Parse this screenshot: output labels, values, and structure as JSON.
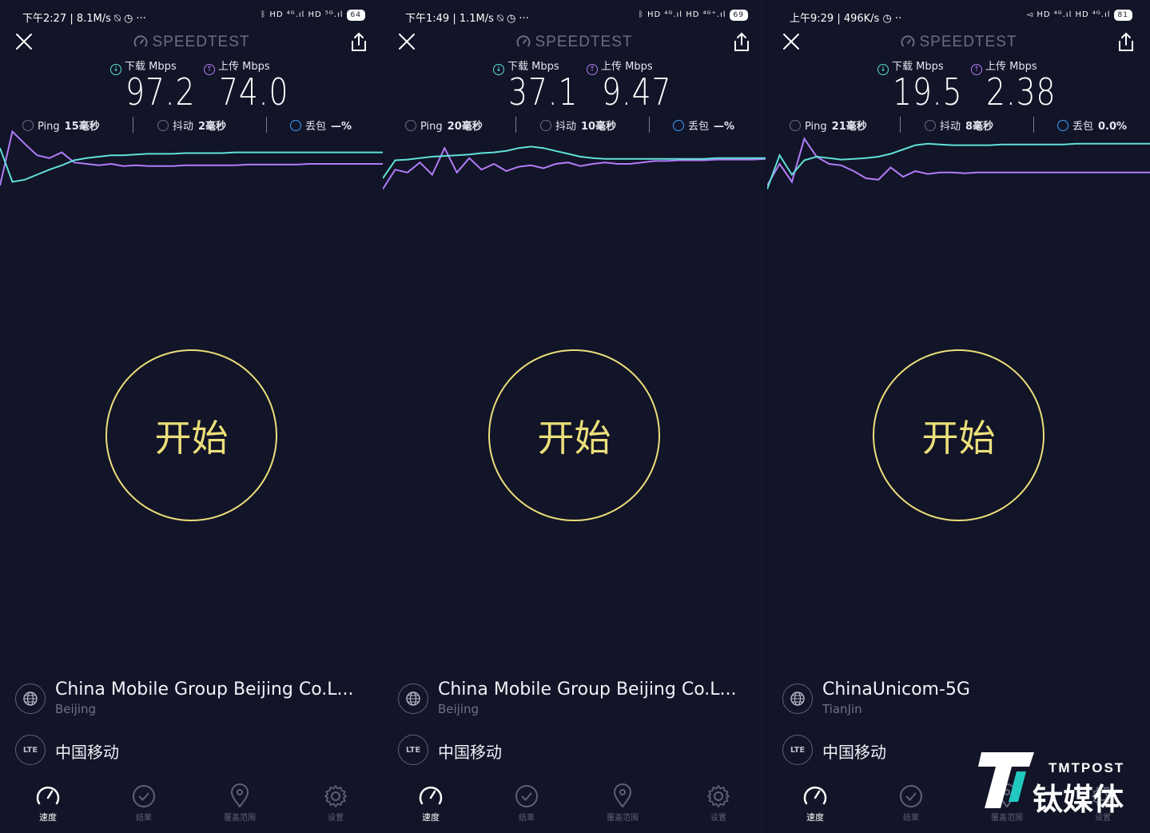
{
  "panels": [
    {
      "status_left": "下午2:27 | 8.1M/s ⍉ ◷ ···",
      "status_right": "ᛒ HD ⁴ᴳ.ıl HD ⁵ᴳ.ıl",
      "battery": "64",
      "brand": "SPEEDTEST",
      "download_label": "下载 Mbps",
      "upload_label": "上传 Mbps",
      "download": "97.2",
      "upload": "74.0",
      "ping_label": "Ping",
      "ping": "15毫秒",
      "jitter_label": "抖动",
      "jitter": "2毫秒",
      "loss_label": "丢包",
      "loss": "—%",
      "start": "开始",
      "host_name": "China Mobile Group Beijing Co.L...",
      "host_location": "Beijing",
      "lte": "LTE",
      "carrier": "中国移动",
      "graph": {
        "download": [
          0.72,
          0.25,
          0.28,
          0.35,
          0.42,
          0.48,
          0.55,
          0.58,
          0.6,
          0.62,
          0.62,
          0.63,
          0.64,
          0.64,
          0.64,
          0.65,
          0.65,
          0.65,
          0.65,
          0.66,
          0.66,
          0.66,
          0.66,
          0.66,
          0.66,
          0.66,
          0.66,
          0.66,
          0.66,
          0.66,
          0.66,
          0.66
        ],
        "upload": [
          0.2,
          0.95,
          0.78,
          0.62,
          0.58,
          0.66,
          0.52,
          0.5,
          0.48,
          0.5,
          0.47,
          0.48,
          0.47,
          0.47,
          0.47,
          0.48,
          0.48,
          0.48,
          0.48,
          0.48,
          0.49,
          0.49,
          0.49,
          0.49,
          0.49,
          0.5,
          0.5,
          0.5,
          0.5,
          0.5,
          0.5,
          0.5
        ]
      }
    },
    {
      "status_left": "下午1:49 | 1.1M/s ⍉ ◷ ···",
      "status_right": "ᛒ HD ⁴ᴳ.ıl HD ⁴ᴳ⁺.ıl",
      "battery": "69",
      "brand": "SPEEDTEST",
      "download_label": "下载 Mbps",
      "upload_label": "上传 Mbps",
      "download": "37.1",
      "upload": "9.47",
      "ping_label": "Ping",
      "ping": "20毫秒",
      "jitter_label": "抖动",
      "jitter": "10毫秒",
      "loss_label": "丢包",
      "loss": "—%",
      "start": "开始",
      "host_name": "China Mobile Group Beijing Co.L...",
      "host_location": "Beijing",
      "lte": "LTE",
      "carrier": "中国移动",
      "graph": {
        "download": [
          0.3,
          0.55,
          0.56,
          0.58,
          0.6,
          0.61,
          0.62,
          0.63,
          0.65,
          0.66,
          0.68,
          0.72,
          0.74,
          0.72,
          0.68,
          0.64,
          0.6,
          0.58,
          0.57,
          0.57,
          0.57,
          0.57,
          0.57,
          0.57,
          0.57,
          0.57,
          0.57,
          0.58,
          0.58,
          0.58,
          0.58,
          0.58
        ],
        "upload": [
          0.15,
          0.42,
          0.38,
          0.52,
          0.35,
          0.72,
          0.38,
          0.58,
          0.42,
          0.5,
          0.4,
          0.46,
          0.48,
          0.44,
          0.5,
          0.52,
          0.47,
          0.5,
          0.52,
          0.5,
          0.5,
          0.52,
          0.54,
          0.54,
          0.55,
          0.55,
          0.55,
          0.56,
          0.56,
          0.56,
          0.56,
          0.57
        ]
      }
    },
    {
      "status_left": "上午9:29 | 496K/s ◷ ··",
      "status_right": "◅ HD ⁴ᴳ.ıl HD ⁴ᴳ.ıl",
      "battery": "81",
      "brand": "SPEEDTEST",
      "download_label": "下载 Mbps",
      "upload_label": "上传 Mbps",
      "download": "19.5",
      "upload": "2.38",
      "ping_label": "Ping",
      "ping": "21毫秒",
      "jitter_label": "抖动",
      "jitter": "8毫秒",
      "loss_label": "丢包",
      "loss": "0.0%",
      "start": "开始",
      "host_name": "ChinaUnicom-5G",
      "host_location": "TianJin",
      "lte": "LTE",
      "carrier": "中国移动",
      "graph": {
        "download": [
          0.15,
          0.62,
          0.35,
          0.55,
          0.6,
          0.58,
          0.56,
          0.57,
          0.58,
          0.6,
          0.64,
          0.7,
          0.76,
          0.78,
          0.77,
          0.76,
          0.76,
          0.76,
          0.76,
          0.77,
          0.77,
          0.77,
          0.77,
          0.77,
          0.77,
          0.78,
          0.78,
          0.78,
          0.78,
          0.78,
          0.78,
          0.78
        ],
        "upload": [
          0.2,
          0.5,
          0.25,
          0.85,
          0.6,
          0.5,
          0.48,
          0.4,
          0.3,
          0.28,
          0.45,
          0.32,
          0.4,
          0.36,
          0.38,
          0.38,
          0.37,
          0.38,
          0.38,
          0.38,
          0.38,
          0.38,
          0.38,
          0.38,
          0.38,
          0.38,
          0.38,
          0.38,
          0.38,
          0.38,
          0.38,
          0.38
        ]
      }
    }
  ],
  "nav": [
    "速度",
    "结果",
    "覆盖范围",
    "设置"
  ],
  "watermark": {
    "en": "TMTPOST",
    "cn": "钛媒体"
  },
  "colors": {
    "download": "#5fe1d9",
    "upload": "#b07cf7",
    "start_ring": "#ecdf7b",
    "watermark_accent": "#22c9c0"
  }
}
